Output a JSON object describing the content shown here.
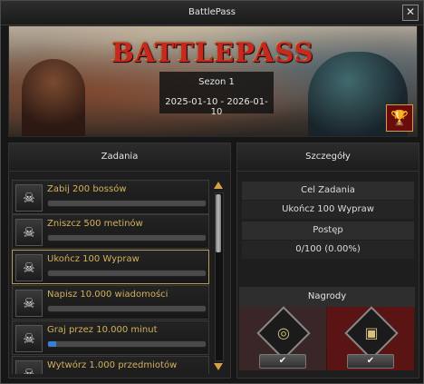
{
  "window": {
    "title": "BattlePass",
    "close_glyph": "✕"
  },
  "banner": {
    "logo_text": "BATTLEPASS",
    "season_label": "Sezon 1",
    "date_range": "2025-01-10 - 2026-01-10",
    "trophy_icon": "trophy-icon"
  },
  "tasks_panel": {
    "title": "Zadania",
    "items": [
      {
        "label": "Zabij 200 bossów",
        "progress": 0.0
      },
      {
        "label": "Zniszcz 500 metinów",
        "progress": 0.0
      },
      {
        "label": "Ukończ 100 Wypraw",
        "progress": 0.0,
        "selected": true
      },
      {
        "label": "Napisz 10.000 wiadomości",
        "progress": 0.0
      },
      {
        "label": "Graj przez 10.000 minut",
        "progress": 0.05
      },
      {
        "label": "Wytwórz 1.000 przedmiotów",
        "progress": 0.0
      }
    ]
  },
  "details_panel": {
    "title": "Szczegóły",
    "goal_header": "Cel Zadania",
    "goal_value": "Ukończ 100 Wypraw",
    "progress_header": "Postęp",
    "progress_value": "0/100 (0.00%)",
    "rewards_header": "Nagrody",
    "rewards": [
      {
        "icon": "ring-icon",
        "button_glyph": "✔"
      },
      {
        "icon": "chest-icon",
        "button_glyph": "✔"
      }
    ]
  },
  "colors": {
    "accent_gold": "#d4b15a",
    "progress_blue": "#3a7fd0",
    "logo_red": "#c8281e"
  }
}
